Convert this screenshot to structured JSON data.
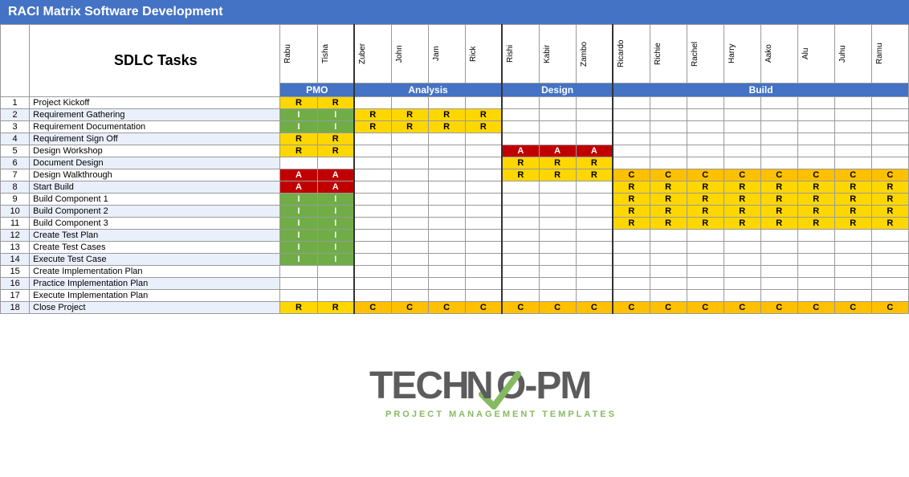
{
  "title": "RACI Matrix Software Development",
  "table": {
    "header_task_label": "SDLC Tasks",
    "groups": [
      {
        "name": "PMO",
        "members": [
          "Rabu",
          "Tisha"
        ],
        "span": 2
      },
      {
        "name": "Analysis",
        "members": [
          "Zuber",
          "John",
          "Jam",
          "Rick"
        ],
        "span": 4
      },
      {
        "name": "Design",
        "members": [
          "Rishi",
          "Kabir",
          "Zambo"
        ],
        "span": 3
      },
      {
        "name": "Build",
        "members": [
          "Ricardo",
          "Richie",
          "Rachel",
          "Harry",
          "Aako",
          "Alu",
          "Juhu",
          "Ramu"
        ],
        "span": 8
      }
    ],
    "rows": [
      {
        "num": 1,
        "task": "Project Kickoff",
        "pmo": [
          "R",
          "R"
        ],
        "analysis": [
          "",
          "",
          "",
          ""
        ],
        "design": [
          "",
          "",
          ""
        ],
        "build": [
          "",
          "",
          "",
          "",
          "",
          "",
          "",
          ""
        ]
      },
      {
        "num": 2,
        "task": "Requirement Gathering",
        "pmo": [
          "I",
          "I"
        ],
        "analysis": [
          "R",
          "R",
          "R",
          "R"
        ],
        "design": [
          "",
          "",
          ""
        ],
        "build": [
          "",
          "",
          "",
          "",
          "",
          "",
          "",
          ""
        ]
      },
      {
        "num": 3,
        "task": "Requirement Documentation",
        "pmo": [
          "I",
          "I"
        ],
        "analysis": [
          "R",
          "R",
          "R",
          "R"
        ],
        "design": [
          "",
          "",
          ""
        ],
        "build": [
          "",
          "",
          "",
          "",
          "",
          "",
          "",
          ""
        ]
      },
      {
        "num": 4,
        "task": "Requirement Sign Off",
        "pmo": [
          "R",
          "R"
        ],
        "analysis": [
          "",
          "",
          "",
          ""
        ],
        "design": [
          "",
          "",
          ""
        ],
        "build": [
          "",
          "",
          "",
          "",
          "",
          "",
          "",
          ""
        ]
      },
      {
        "num": 5,
        "task": "Design Workshop",
        "pmo": [
          "R",
          "R"
        ],
        "analysis": [
          "",
          "",
          "",
          ""
        ],
        "design": [
          "A",
          "A",
          "A"
        ],
        "build": [
          "",
          "",
          "",
          "",
          "",
          "",
          "",
          ""
        ]
      },
      {
        "num": 6,
        "task": "Document Design",
        "pmo": [
          "",
          ""
        ],
        "analysis": [
          "",
          "",
          "",
          ""
        ],
        "design": [
          "R",
          "R",
          "R"
        ],
        "build": [
          "",
          "",
          "",
          "",
          "",
          "",
          "",
          ""
        ]
      },
      {
        "num": 7,
        "task": "Design Walkthrough",
        "pmo": [
          "A",
          "A"
        ],
        "analysis": [
          "",
          "",
          "",
          ""
        ],
        "design": [
          "R",
          "R",
          "R"
        ],
        "build": [
          "C",
          "C",
          "C",
          "C",
          "C",
          "C",
          "C",
          "C"
        ]
      },
      {
        "num": 8,
        "task": "Start Build",
        "pmo": [
          "A",
          "A"
        ],
        "analysis": [
          "",
          "",
          "",
          ""
        ],
        "design": [
          "",
          "",
          ""
        ],
        "build": [
          "R",
          "R",
          "R",
          "R",
          "R",
          "R",
          "R",
          "R"
        ]
      },
      {
        "num": 9,
        "task": "Build Component 1",
        "pmo": [
          "I",
          "I"
        ],
        "analysis": [
          "",
          "",
          "",
          ""
        ],
        "design": [
          "",
          "",
          ""
        ],
        "build": [
          "R",
          "R",
          "R",
          "R",
          "R",
          "R",
          "R",
          "R"
        ]
      },
      {
        "num": 10,
        "task": "Build Component 2",
        "pmo": [
          "I",
          "I"
        ],
        "analysis": [
          "",
          "",
          "",
          ""
        ],
        "design": [
          "",
          "",
          ""
        ],
        "build": [
          "R",
          "R",
          "R",
          "R",
          "R",
          "R",
          "R",
          "R"
        ]
      },
      {
        "num": 11,
        "task": "Build Component 3",
        "pmo": [
          "I",
          "I"
        ],
        "analysis": [
          "",
          "",
          "",
          ""
        ],
        "design": [
          "",
          "",
          ""
        ],
        "build": [
          "R",
          "R",
          "R",
          "R",
          "R",
          "R",
          "R",
          "R"
        ]
      },
      {
        "num": 12,
        "task": "Create Test Plan",
        "pmo": [
          "I",
          "I"
        ],
        "analysis": [
          "",
          "",
          "",
          ""
        ],
        "design": [
          "",
          "",
          ""
        ],
        "build": [
          "",
          "",
          "",
          "",
          "",
          "",
          "",
          ""
        ]
      },
      {
        "num": 13,
        "task": "Create Test Cases",
        "pmo": [
          "I",
          "I"
        ],
        "analysis": [
          "",
          "",
          "",
          ""
        ],
        "design": [
          "",
          "",
          ""
        ],
        "build": [
          "",
          "",
          "",
          "",
          "",
          "",
          "",
          ""
        ]
      },
      {
        "num": 14,
        "task": "Execute Test Case",
        "pmo": [
          "I",
          "I"
        ],
        "analysis": [
          "",
          "",
          "",
          ""
        ],
        "design": [
          "",
          "",
          ""
        ],
        "build": [
          "",
          "",
          "",
          "",
          "",
          "",
          "",
          ""
        ]
      },
      {
        "num": 15,
        "task": "Create Implementation Plan",
        "pmo": [
          "",
          ""
        ],
        "analysis": [
          "",
          "",
          "",
          ""
        ],
        "design": [
          "",
          "",
          ""
        ],
        "build": [
          "",
          "",
          "",
          "",
          "",
          "",
          "",
          ""
        ]
      },
      {
        "num": 16,
        "task": "Practice Implementation Plan",
        "pmo": [
          "",
          ""
        ],
        "analysis": [
          "",
          "",
          "",
          ""
        ],
        "design": [
          "",
          "",
          ""
        ],
        "build": [
          "",
          "",
          "",
          "",
          "",
          "",
          "",
          ""
        ]
      },
      {
        "num": 17,
        "task": "Execute Implementation Plan",
        "pmo": [
          "",
          ""
        ],
        "analysis": [
          "",
          "",
          "",
          ""
        ],
        "design": [
          "",
          "",
          ""
        ],
        "build": [
          "",
          "",
          "",
          "",
          "",
          "",
          "",
          ""
        ]
      },
      {
        "num": 18,
        "task": "Close Project",
        "pmo": [
          "R",
          "R"
        ],
        "analysis": [
          "C",
          "C",
          "C",
          "C"
        ],
        "design": [
          "C",
          "C",
          "C"
        ],
        "build": [
          "C",
          "C",
          "C",
          "C",
          "C",
          "C",
          "C",
          "C"
        ]
      }
    ]
  }
}
